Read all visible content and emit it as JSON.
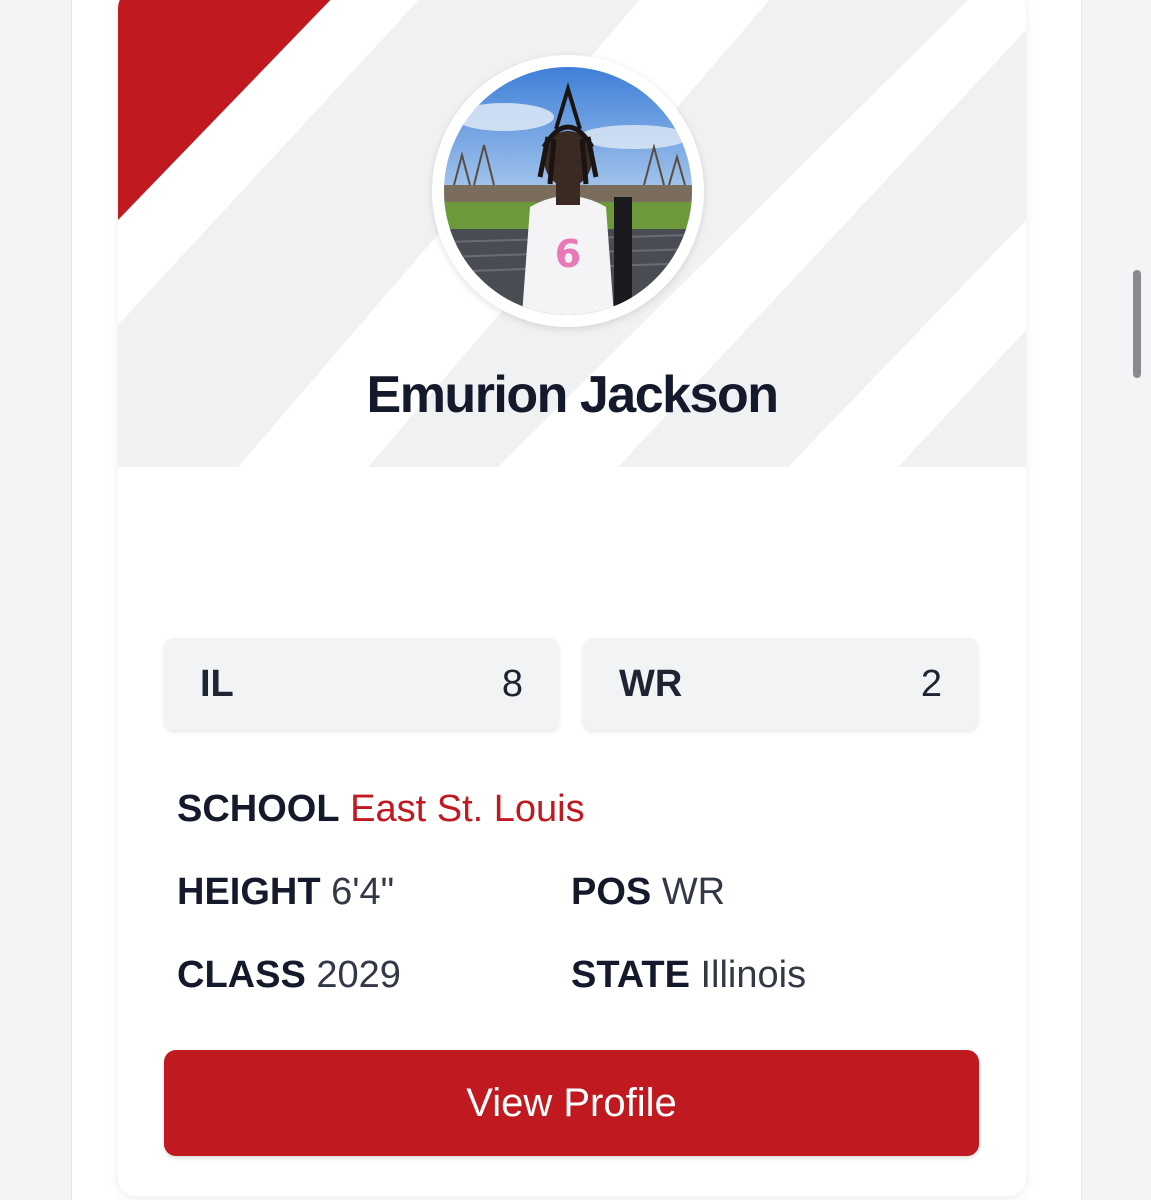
{
  "player": {
    "name": "Emurion Jackson",
    "photo_icon": "player-photo"
  },
  "ranks": [
    {
      "label": "IL",
      "value": "8"
    },
    {
      "label": "WR",
      "value": "2"
    }
  ],
  "info": {
    "school_label": "SCHOOL",
    "school_value": "East St. Louis",
    "height_label": "HEIGHT",
    "height_value": "6'4\"",
    "pos_label": "POS",
    "pos_value": "WR",
    "class_label": "CLASS",
    "class_value": "2029",
    "state_label": "STATE",
    "state_value": "Illinois"
  },
  "actions": {
    "view_profile_label": "View Profile"
  },
  "colors": {
    "accent_red": "#c0191f",
    "name_text": "#141a2b",
    "header_bg": "#f0f1f3"
  }
}
